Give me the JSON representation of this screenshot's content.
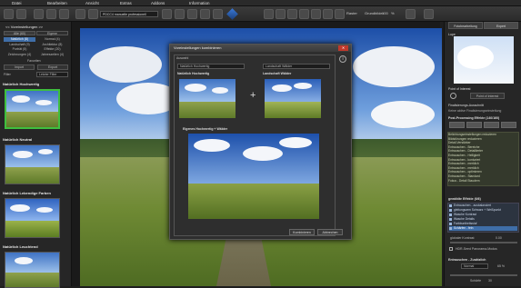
{
  "menu": [
    "Datei",
    "Bearbeiten",
    "Ansicht",
    "Extras",
    "Addons",
    "Information"
  ],
  "toolbar": {
    "preset_select": "PDCC4 manuelle professionell",
    "grid_label": "Raster",
    "zoom_label": "Grundbilder",
    "zoom_value": "100",
    "zoom_unit": "%"
  },
  "left_panel": {
    "title": "<< Voreinstellungen >>",
    "tabs": [
      "Alle (60)",
      "Eigene"
    ],
    "categories": [
      [
        "Natürlich (8)",
        "Normal (4)"
      ],
      [
        "Landschaft (9)",
        "Architektur (8)"
      ],
      [
        "Porträt (5)",
        "Effekte (20)"
      ],
      [
        "Zeichnungen (4)",
        "Jahreszeiten (4)"
      ]
    ],
    "favorites_label": "Favoriten",
    "import_button": "Import",
    "export_button": "Export",
    "filter_label": "Filter",
    "filter_value": "Letzter Filter",
    "presets": [
      "Natürlich Hochwertig",
      "Natürlich Neutral",
      "Natürlich Lebendige Farben",
      "Natürlich Leuchtend"
    ]
  },
  "dialog": {
    "title": "Voreinstellungen kombinieren",
    "group_label": "Auswahl",
    "left_select": "Natürlich Hochwertig",
    "right_select": "Landschaft Wälder",
    "left_label": "Natürlich Hochwertig",
    "right_label": "Landschaft Wälder",
    "result_label": "Eigenes Hochwertig + Wälder",
    "ok_button": "Kombinieren",
    "cancel_button": "Abbrechen"
  },
  "right_panel": {
    "tabs": [
      "Fotobearbeitung",
      "Expert"
    ],
    "loupe_label": "Lupe",
    "poi_label": "Point of Interest",
    "poi_button": "Point of Interest",
    "post_label": "Finalisierungs-Ausschnitt",
    "post_value": "Keine aktive Finalisierungseinstellung",
    "filters_header": "Post-Processing Effekte (140/160)",
    "filter_list": [
      "Belichtungseinstellungen reduzieren",
      "Bildstörungen reduzieren",
      "Detail-Verstärker",
      "Entrauschen - Bereiche",
      "Entrauschen - Detaillierter",
      "Entrauschen - Helligkeit",
      "Entrauschen - konturiert",
      "Entrauschen - merklich",
      "Entrauschen - merklich",
      "Entrauschen - optimieren",
      "Entrauschen - Standard",
      "Fokus - Detail Staudern"
    ],
    "active_header": "gewählte Effekte (6/6)",
    "active_list": [
      "Entrauschen - ausbalanciert",
      "gleitungsarm Schwarz + Weißpunkt",
      "Wasche Kontrast",
      "Wasche Details",
      "Farbbuntheitsstuf",
      "Schärfen - fein"
    ],
    "global_label": "globaler Kontrast",
    "global_value": "0.00",
    "hdr_label": "HDR-Seed Panorama-Modus",
    "bottom_header": "Entrauschen - Zusätzlich",
    "bottom_select": "Normal",
    "bottom_value": "65 %",
    "bottom_slider_label": "Schärfe",
    "bottom_slider_value": "30"
  },
  "colors": {
    "accent_green": "#3fbf3f",
    "selection_blue": "#3f6ea8"
  }
}
